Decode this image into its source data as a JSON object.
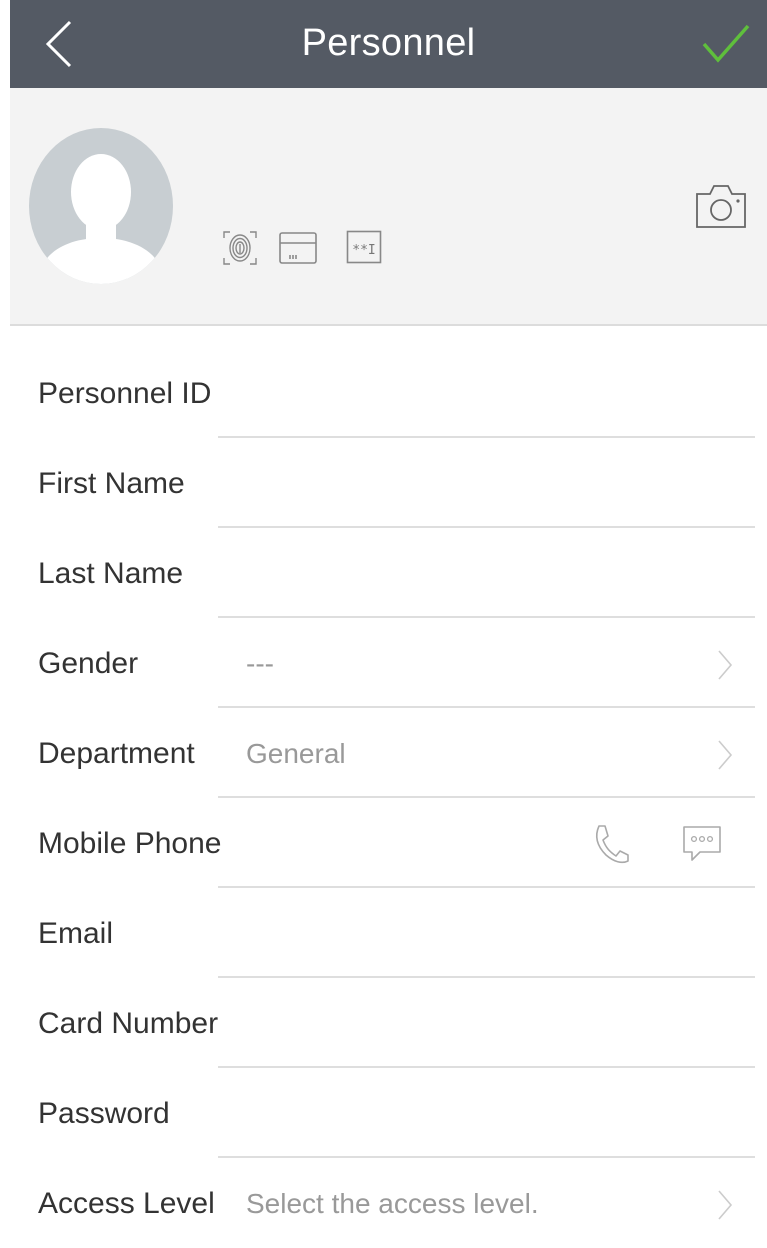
{
  "header": {
    "title": "Personnel",
    "back_icon": "chevron-left-icon",
    "confirm_icon": "checkmark-icon",
    "confirm_color": "#5fbf3c",
    "background": "#545a64"
  },
  "profile": {
    "avatar_icon": "avatar-placeholder-icon",
    "credential_icons": [
      "fingerprint-icon",
      "card-icon",
      "password-icon"
    ],
    "password_icon_text": "**I",
    "camera_icon": "camera-icon"
  },
  "form": {
    "fields": [
      {
        "label": "Personnel ID",
        "value": ""
      },
      {
        "label": "First Name",
        "value": ""
      },
      {
        "label": "Last Name",
        "value": ""
      },
      {
        "label": "Gender",
        "value": "---"
      },
      {
        "label": "Department",
        "value": "General"
      },
      {
        "label": "Mobile Phone",
        "value": ""
      },
      {
        "label": "Email",
        "value": ""
      },
      {
        "label": "Card Number",
        "value": ""
      },
      {
        "label": "Password",
        "value": ""
      },
      {
        "label": "Access Level",
        "value": "Select the access level."
      }
    ]
  }
}
